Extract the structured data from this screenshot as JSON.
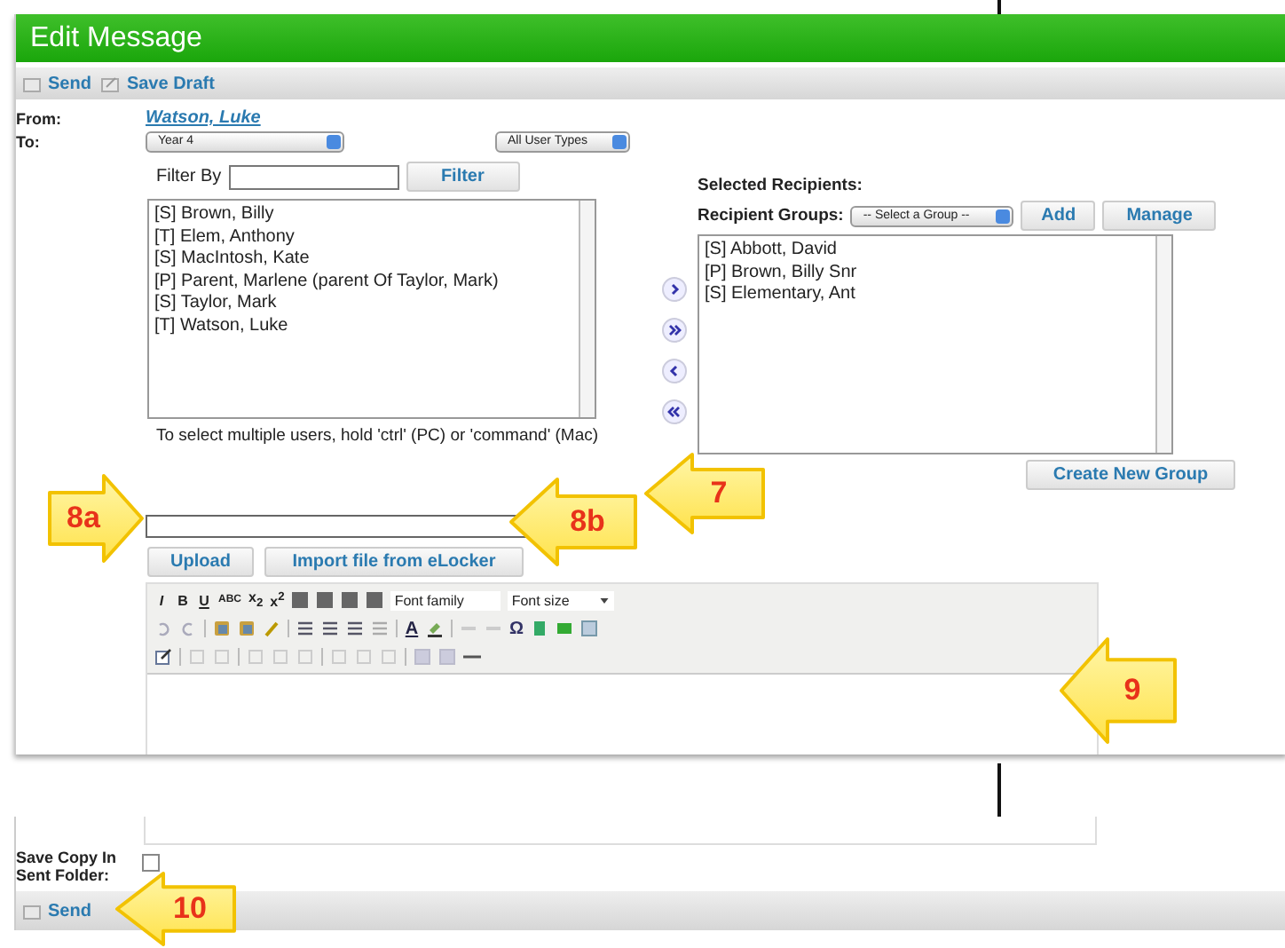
{
  "window": {
    "title": "Edit Message"
  },
  "toolbar": [
    {
      "label": "Send",
      "kind": "send"
    },
    {
      "label": "Save Draft",
      "kind": "draft"
    }
  ],
  "from": {
    "label": "From:",
    "value": "Watson, Luke"
  },
  "to": {
    "label": "To:",
    "class_select": "Year 4",
    "type_select": "All User Types",
    "filter_label": "Filter By",
    "filter_button": "Filter"
  },
  "available": [
    "[S] Brown, Billy",
    "[T] Elem, Anthony",
    "[S] MacIntosh, Kate",
    "[P] Parent, Marlene (parent Of Taylor, Mark)",
    "[S] Taylor, Mark",
    "[T] Watson, Luke"
  ],
  "hint": "To select multiple users, hold 'ctrl' (PC) or 'command' (Mac)",
  "selected": {
    "heading": "Selected Recipients:",
    "groups_label": "Recipient Groups:",
    "group_select": "-- Select a Group --",
    "add": "Add",
    "manage": "Manage",
    "create_group": "Create New Group",
    "recipients": [
      "[S] Abbott, David",
      "[P] Brown, Billy Snr",
      "[S] Elementary, Ant"
    ]
  },
  "attach": {
    "upload": "Upload",
    "import": "Import file from eLocker"
  },
  "editor": {
    "format_buttons": [
      {
        "label": "I",
        "kind": "italic"
      },
      {
        "label": "B",
        "kind": "bold"
      },
      {
        "label": "U",
        "kind": "underline"
      },
      {
        "label": "ABC",
        "kind": "strike"
      },
      {
        "label": "x$_{2}$",
        "kind": "plain"
      },
      {
        "label": "x$^{2}$",
        "kind": "plain"
      }
    ],
    "font_family": "Font family",
    "font_size": "Font size",
    "color_letter": "A",
    "special_char": "Ω"
  },
  "footer": {
    "save_copy_label": "Save Copy In Sent Folder:",
    "save_copy_checked": false,
    "send": "Send"
  },
  "callouts": [
    {
      "label": "8a"
    },
    {
      "label": "8b"
    },
    {
      "label": "7"
    },
    {
      "label": "9"
    },
    {
      "label": "10"
    }
  ]
}
